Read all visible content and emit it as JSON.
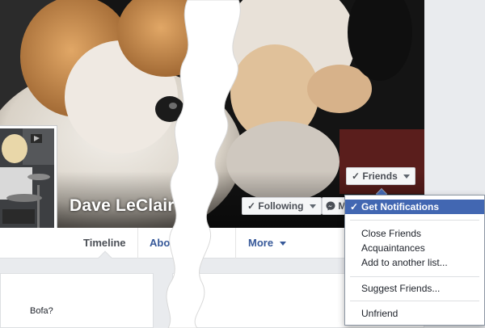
{
  "profile": {
    "name": "Dave LeClair"
  },
  "tabs": [
    {
      "label": "Timeline",
      "active": true
    },
    {
      "label": "About"
    },
    {
      "label": "More"
    }
  ],
  "buttons": {
    "friends": "Friends",
    "following": "Following",
    "message_partial": "M"
  },
  "menu": {
    "items": [
      {
        "label": "Get Notifications",
        "checked": true
      },
      {
        "label": "Close Friends"
      },
      {
        "label": "Acquaintances"
      },
      {
        "label": "Add to another list..."
      },
      {
        "label": "Suggest Friends..."
      },
      {
        "label": "Unfriend"
      }
    ]
  },
  "feed": {
    "snippet": "Bofa?"
  },
  "colors": {
    "fb_blue": "#4267b2",
    "link_blue": "#365899",
    "page_bg": "#e9ebee"
  }
}
